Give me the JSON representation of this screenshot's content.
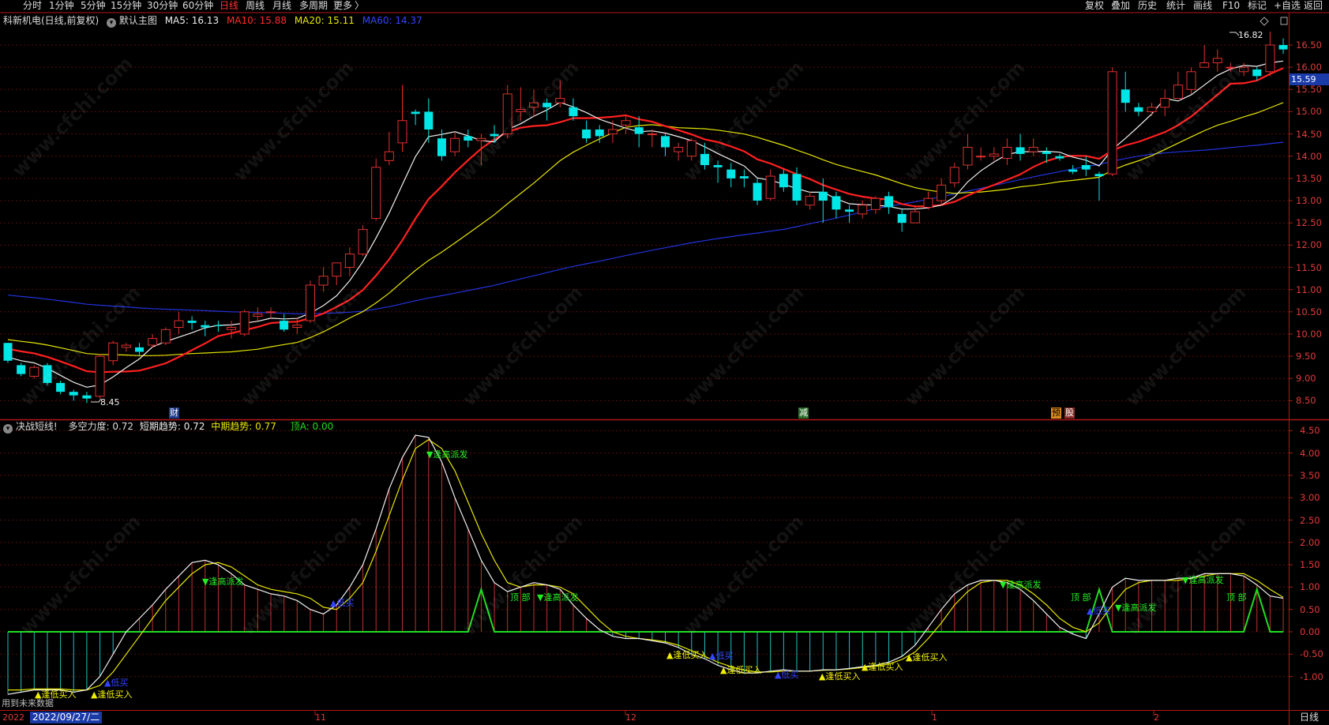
{
  "toolbar": {
    "periods": [
      "分时",
      "1分钟",
      "5分钟",
      "15分钟",
      "30分钟",
      "60分钟",
      "日线",
      "周线",
      "月线",
      "多周期",
      "更多"
    ],
    "active_period": "日线",
    "more_arrow": "〉",
    "right_items": [
      "复权",
      "叠加",
      "历史",
      "统计",
      "画线",
      "F10",
      "+自选",
      "返回"
    ],
    "mark_label": "标记"
  },
  "main_legend": {
    "collapse_icon": "chevron-down-icon",
    "stock": "科新机电(日线,前复权)",
    "template": "默认主图",
    "ma5": "MA5: 16.13",
    "ma10": "MA10: 15.88",
    "ma20": "MA20: 15.11",
    "ma60": "MA60: 14.37"
  },
  "colors": {
    "up": "#e03030",
    "down": "#00e5e5",
    "ma5": "#f0f0f0",
    "ma10": "#ff2020",
    "ma20": "#e6e600",
    "ma60": "#2233dd",
    "short": "#f0f0f0",
    "mid": "#e6e600",
    "green": "#22dd22",
    "axis": "#b01818"
  },
  "price_labels": {
    "high": "16.82",
    "low": "8.45",
    "current": "15.59"
  },
  "price_axis": [
    "16.50",
    "16.00",
    "15.50",
    "15.00",
    "14.50",
    "14.00",
    "13.50",
    "13.00",
    "12.50",
    "12.00",
    "11.50",
    "11.00",
    "10.50",
    "10.00",
    "9.50",
    "9.00",
    "8.50"
  ],
  "event_markers": [
    "财",
    "减",
    "预",
    "股"
  ],
  "sub_legend": {
    "name": "决战短线!",
    "power": "多空力度: 0.72",
    "short_trend": "短期趋势: 0.72",
    "mid_trend": "中期趋势: 0.77",
    "top_a": "顶A: 0.00"
  },
  "sub_axis": [
    "4.50",
    "4.00",
    "3.50",
    "3.00",
    "2.50",
    "2.00",
    "1.50",
    "1.00",
    "0.50",
    "0.00",
    "-0.50",
    "-1.00"
  ],
  "signals": {
    "buy_low": "逢低买入",
    "sell_high": "逢高派发",
    "low_buy": "低买",
    "top": "顶 部"
  },
  "footer": {
    "future_data": "用到未来数据",
    "cursor_date": "2022/09/27/二",
    "year_prefix": "2022",
    "month_labels": [
      "11",
      "12",
      "1",
      "2"
    ],
    "period": "日线"
  },
  "watermark": "www.cfchi.com",
  "chart_data": {
    "type": "candlestick",
    "title": "科新机电(日线,前复权)",
    "ylim": [
      8.2,
      16.9
    ],
    "moving_averages": {
      "MA5": 16.13,
      "MA10": 15.88,
      "MA20": 15.11,
      "MA60": 14.37
    },
    "candles": [
      [
        9.8,
        9.4,
        9.8,
        9.35
      ],
      [
        9.3,
        9.1,
        9.35,
        9.05
      ],
      [
        9.05,
        9.25,
        9.3,
        9.0
      ],
      [
        9.3,
        8.9,
        9.35,
        8.85
      ],
      [
        8.9,
        8.7,
        8.95,
        8.65
      ],
      [
        8.7,
        8.62,
        8.75,
        8.5
      ],
      [
        8.62,
        8.55,
        8.7,
        8.45
      ],
      [
        8.6,
        9.5,
        9.55,
        8.55
      ],
      [
        9.4,
        9.8,
        9.85,
        9.3
      ],
      [
        9.7,
        9.75,
        9.8,
        9.6
      ],
      [
        9.7,
        9.6,
        9.8,
        9.5
      ],
      [
        9.75,
        9.9,
        10.0,
        9.7
      ],
      [
        9.8,
        10.1,
        10.15,
        9.75
      ],
      [
        10.15,
        10.3,
        10.5,
        10.0
      ],
      [
        10.3,
        10.25,
        10.4,
        10.1
      ],
      [
        10.2,
        10.15,
        10.3,
        9.95
      ],
      [
        10.2,
        10.18,
        10.3,
        10.05
      ],
      [
        10.1,
        10.15,
        10.3,
        9.9
      ],
      [
        10.0,
        10.5,
        10.55,
        9.95
      ],
      [
        10.4,
        10.45,
        10.6,
        10.3
      ],
      [
        10.5,
        10.5,
        10.6,
        10.35
      ],
      [
        10.3,
        10.1,
        10.45,
        10.05
      ],
      [
        10.15,
        10.2,
        10.35,
        10.0
      ],
      [
        10.3,
        11.1,
        11.2,
        10.25
      ],
      [
        11.1,
        11.3,
        11.5,
        10.95
      ],
      [
        11.3,
        11.6,
        11.6,
        11.1
      ],
      [
        11.5,
        11.8,
        11.95,
        11.3
      ],
      [
        11.8,
        12.35,
        12.45,
        11.75
      ],
      [
        12.6,
        13.75,
        13.95,
        12.55
      ],
      [
        13.9,
        14.1,
        14.55,
        13.8
      ],
      [
        14.3,
        14.8,
        15.6,
        14.1
      ],
      [
        15.0,
        14.95,
        15.05,
        14.7
      ],
      [
        15.0,
        14.6,
        15.3,
        14.3
      ],
      [
        14.4,
        14.0,
        14.6,
        13.9
      ],
      [
        14.1,
        14.4,
        14.55,
        14.0
      ],
      [
        14.45,
        14.35,
        14.6,
        14.2
      ],
      [
        14.35,
        14.4,
        14.5,
        13.8
      ],
      [
        14.5,
        14.45,
        14.7,
        14.3
      ],
      [
        14.5,
        15.4,
        15.6,
        14.4
      ],
      [
        15.0,
        15.05,
        15.55,
        14.8
      ],
      [
        15.1,
        15.2,
        15.5,
        14.9
      ],
      [
        15.2,
        15.1,
        15.3,
        14.8
      ],
      [
        15.2,
        15.3,
        15.7,
        15.1
      ],
      [
        15.1,
        14.9,
        15.3,
        14.8
      ],
      [
        14.6,
        14.4,
        14.8,
        14.3
      ],
      [
        14.6,
        14.45,
        14.7,
        14.3
      ],
      [
        14.5,
        14.6,
        14.8,
        14.3
      ],
      [
        14.7,
        14.8,
        14.9,
        14.5
      ],
      [
        14.65,
        14.5,
        14.9,
        14.2
      ],
      [
        14.5,
        14.5,
        14.6,
        14.2
      ],
      [
        14.45,
        14.2,
        14.5,
        14.0
      ],
      [
        14.1,
        14.2,
        14.3,
        13.9
      ],
      [
        14.0,
        14.35,
        14.4,
        13.9
      ],
      [
        14.05,
        13.8,
        14.3,
        13.7
      ],
      [
        13.8,
        13.75,
        13.9,
        13.4
      ],
      [
        13.7,
        13.5,
        13.85,
        13.3
      ],
      [
        13.55,
        13.5,
        13.7,
        13.3
      ],
      [
        13.4,
        13.0,
        13.5,
        12.9
      ],
      [
        13.05,
        13.55,
        13.7,
        13.0
      ],
      [
        13.6,
        13.3,
        13.7,
        13.2
      ],
      [
        13.6,
        13.0,
        13.75,
        12.9
      ],
      [
        12.9,
        13.1,
        13.2,
        12.8
      ],
      [
        13.2,
        13.0,
        13.5,
        12.5
      ],
      [
        13.1,
        12.8,
        13.2,
        12.6
      ],
      [
        12.8,
        12.75,
        12.9,
        12.5
      ],
      [
        12.7,
        12.9,
        13.0,
        12.6
      ],
      [
        12.8,
        13.05,
        13.1,
        12.7
      ],
      [
        13.1,
        12.85,
        13.2,
        12.7
      ],
      [
        12.7,
        12.5,
        12.8,
        12.3
      ],
      [
        12.5,
        12.75,
        12.9,
        12.5
      ],
      [
        12.85,
        13.05,
        13.2,
        12.8
      ],
      [
        13.0,
        13.35,
        13.5,
        12.9
      ],
      [
        13.4,
        13.75,
        13.85,
        13.3
      ],
      [
        13.8,
        14.2,
        14.5,
        13.7
      ],
      [
        14.0,
        14.0,
        14.2,
        13.9
      ],
      [
        14.0,
        14.05,
        14.2,
        13.9
      ],
      [
        13.95,
        14.2,
        14.4,
        13.8
      ],
      [
        14.2,
        14.05,
        14.5,
        13.9
      ],
      [
        14.1,
        14.2,
        14.4,
        14.0
      ],
      [
        14.1,
        14.05,
        14.2,
        13.85
      ],
      [
        14.0,
        13.95,
        14.05,
        13.9
      ],
      [
        13.7,
        13.65,
        13.8,
        13.6
      ],
      [
        13.8,
        13.7,
        14.0,
        13.55
      ],
      [
        13.6,
        13.55,
        13.65,
        13.0
      ],
      [
        13.6,
        15.9,
        16.0,
        13.55
      ],
      [
        15.5,
        15.2,
        15.9,
        15.0
      ],
      [
        15.1,
        15.0,
        15.2,
        14.9
      ],
      [
        15.0,
        15.1,
        15.2,
        14.9
      ],
      [
        15.1,
        15.3,
        15.5,
        14.9
      ],
      [
        15.3,
        15.6,
        15.9,
        15.3
      ],
      [
        15.5,
        15.9,
        16.0,
        15.4
      ],
      [
        16.0,
        16.1,
        16.5,
        16.0
      ],
      [
        16.1,
        16.2,
        16.4,
        15.9
      ],
      [
        16.0,
        16.0,
        16.1,
        15.9
      ],
      [
        15.9,
        16.0,
        16.1,
        15.8
      ],
      [
        15.95,
        15.8,
        16.0,
        15.7
      ],
      [
        15.9,
        16.5,
        16.8,
        15.8
      ],
      [
        16.5,
        16.4,
        16.65,
        16.3
      ]
    ],
    "sub_indicator": {
      "name": "决战短线!",
      "short_trend_last": 0.72,
      "mid_trend_last": 0.77,
      "top_a_last": 0.0,
      "ylim": [
        -1.5,
        4.7
      ],
      "short": [
        -1.4,
        -1.35,
        -1.3,
        -1.3,
        -1.3,
        -1.35,
        -1.3,
        -1.0,
        -0.5,
        0.0,
        0.3,
        0.6,
        0.95,
        1.25,
        1.55,
        1.6,
        1.5,
        1.3,
        1.05,
        0.95,
        0.85,
        0.8,
        0.7,
        0.5,
        0.4,
        0.6,
        1.0,
        1.5,
        2.3,
        3.2,
        3.9,
        4.4,
        4.35,
        3.8,
        3.0,
        2.3,
        1.6,
        1.1,
        0.9,
        1.0,
        1.1,
        1.05,
        0.95,
        0.6,
        0.3,
        0.05,
        -0.1,
        -0.15,
        -0.15,
        -0.2,
        -0.25,
        -0.35,
        -0.5,
        -0.6,
        -0.75,
        -0.85,
        -0.92,
        -0.92,
        -0.88,
        -0.85,
        -0.88,
        -0.88,
        -0.85,
        -0.85,
        -0.82,
        -0.78,
        -0.75,
        -0.68,
        -0.55,
        -0.3,
        0.1,
        0.5,
        0.85,
        1.05,
        1.15,
        1.15,
        1.1,
        0.95,
        0.7,
        0.4,
        0.1,
        -0.05,
        -0.15,
        0.4,
        1.0,
        1.2,
        1.15,
        1.15,
        1.15,
        1.2,
        1.2,
        1.3,
        1.3,
        1.3,
        1.25,
        1.05,
        0.8,
        0.75
      ],
      "mid": [
        -1.3,
        -1.3,
        -1.28,
        -1.28,
        -1.28,
        -1.3,
        -1.3,
        -1.2,
        -0.9,
        -0.5,
        -0.1,
        0.3,
        0.7,
        1.0,
        1.3,
        1.5,
        1.55,
        1.45,
        1.25,
        1.05,
        0.95,
        0.9,
        0.85,
        0.75,
        0.55,
        0.5,
        0.75,
        1.1,
        1.8,
        2.6,
        3.4,
        4.1,
        4.3,
        4.1,
        3.6,
        2.9,
        2.2,
        1.6,
        1.1,
        1.0,
        1.05,
        1.05,
        1.0,
        0.85,
        0.55,
        0.25,
        0.0,
        -0.1,
        -0.15,
        -0.18,
        -0.22,
        -0.3,
        -0.42,
        -0.55,
        -0.68,
        -0.78,
        -0.86,
        -0.9,
        -0.9,
        -0.88,
        -0.88,
        -0.88,
        -0.86,
        -0.85,
        -0.83,
        -0.8,
        -0.77,
        -0.72,
        -0.62,
        -0.45,
        -0.15,
        0.2,
        0.6,
        0.9,
        1.1,
        1.15,
        1.15,
        1.05,
        0.85,
        0.6,
        0.3,
        0.1,
        0.0,
        0.2,
        0.6,
        0.95,
        1.1,
        1.15,
        1.15,
        1.15,
        1.2,
        1.25,
        1.3,
        1.3,
        1.3,
        1.15,
        0.95,
        0.77
      ]
    }
  }
}
